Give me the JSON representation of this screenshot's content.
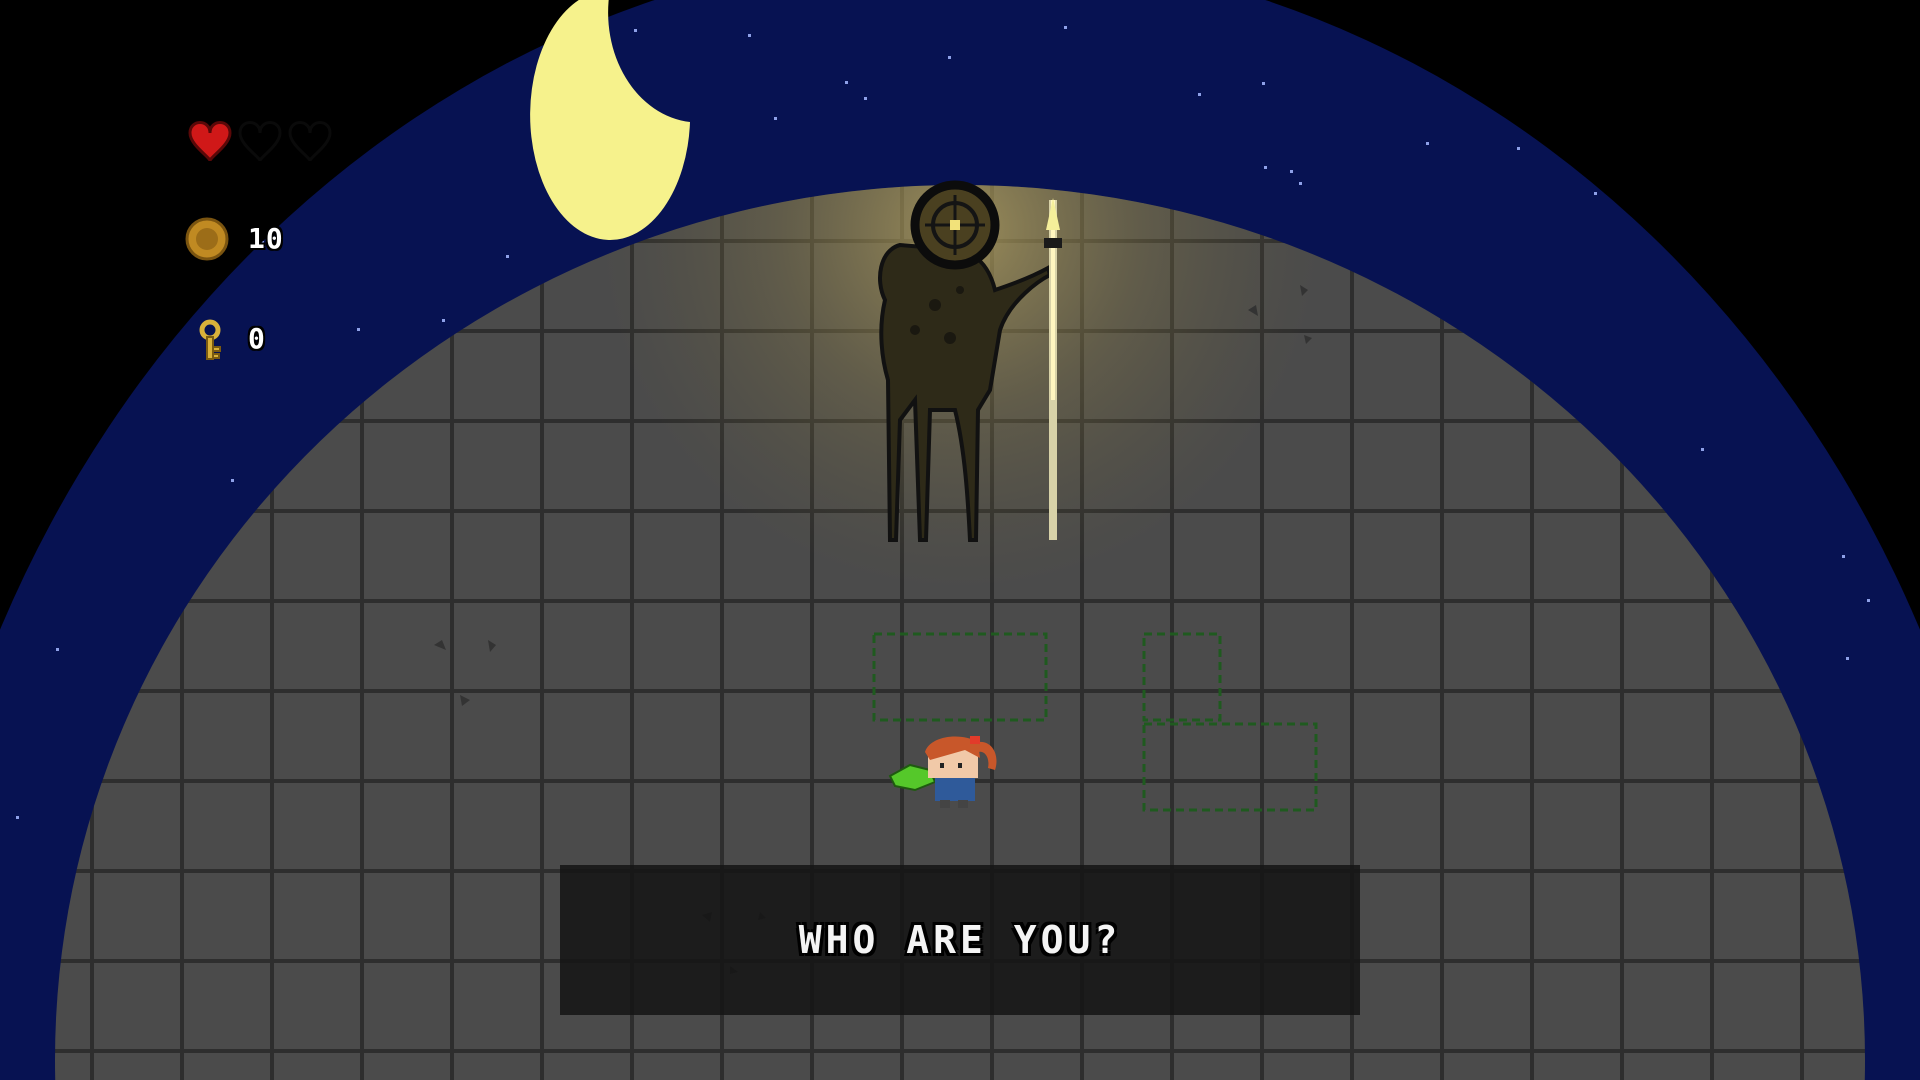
{
  "hud": {
    "hearts": {
      "full": 1,
      "total": 3
    },
    "coins": "10",
    "keys": "0"
  },
  "dialog": {
    "text": "WHO ARE YOU?"
  },
  "colors": {
    "sky": "#071252",
    "floor": "#4a4a4a",
    "grid": "#2c2c2c",
    "moon": "#f6f28c",
    "heart": "#d01818",
    "coin": "#c08a22",
    "key": "#d9b03a"
  }
}
